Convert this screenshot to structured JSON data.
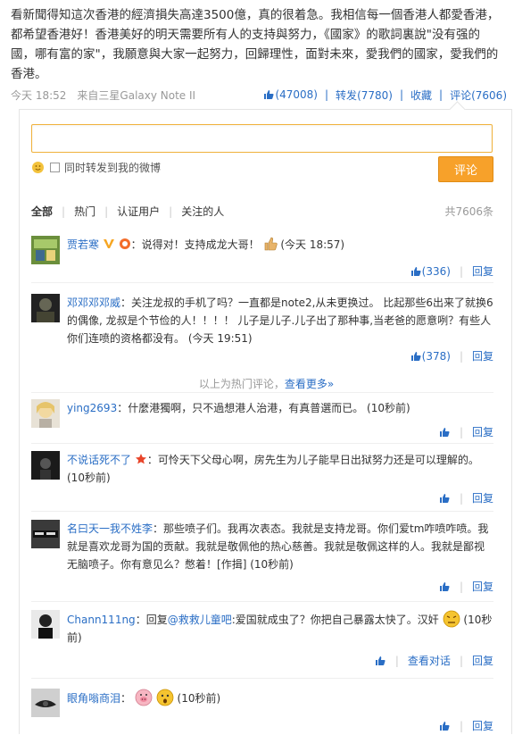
{
  "post": {
    "text": "看新聞得知這次香港的經濟損失高達3500億，真的很着急。我相信每一個香港人都愛香港，都希望香港好！香港美好的明天需要所有人的支持與努力，《國家》的歌詞裏說\"没有强的國，哪有富的家\"，我願意與大家一起努力，回歸理性，面對未來，愛我們的國家，愛我們的香港。"
  },
  "meta": {
    "time": "今天 18:52",
    "source_prefix": "来自",
    "source": "三星Galaxy Note II",
    "like_count": "(47008)",
    "repost_label": "转发",
    "repost_count": "(7780)",
    "favorite_label": "收藏",
    "comment_label": "评论",
    "comment_count": "(7606)"
  },
  "compose": {
    "placeholder": "",
    "also_repost_label": "同时转发到我的微博",
    "submit_label": "评论"
  },
  "tabs": {
    "items": [
      "全部",
      "热门",
      "认证用户",
      "关注的人"
    ],
    "total": "共7606条"
  },
  "hot_comments": [
    {
      "name": "贾若寒",
      "text": "：说得对！支持成龙大哥！",
      "time": "(今天 18:57)",
      "likes": "(336)",
      "reply": "回复"
    },
    {
      "name": "邓邓邓邓威",
      "text": "：关注龙叔的手机了吗？一直都是note2,从未更换过。 比起那些6出来了就换6的偶像, 龙叔是个节俭的人！！！！ 儿子是儿子.儿子出了那种事,当老爸的愿意咧？有些人你们连喷的资格都没有。",
      "time": "(今天 19:51)",
      "likes": "(378)",
      "reply": "回复"
    }
  ],
  "hot_footer": {
    "text": "以上为热门评论，",
    "link": "查看更多»"
  },
  "comments": [
    {
      "name": "ying2693",
      "text": "：什麼港獨啊，只不過想港人治港，有真普選而已。",
      "time": "(10秒前)",
      "reply": "回复"
    },
    {
      "name": "不说话死不了",
      "text": "：可怜天下父母心啊，房先生为儿子能早日出狱努力还是可以理解的。",
      "time": "(10秒前)",
      "reply": "回复"
    },
    {
      "name": "名曰天一我不姓李",
      "text": "：那些喷子们。我再次表态。我就是支持龙哥。你们爱tm咋喷咋喷。我就是喜欢龙哥为国的贡献。我就是敬佩他的热心慈善。我就是敬佩这样的人。我就是鄙视无脑喷子。你有意见么？憋着！",
      "tag": "[作揖]",
      "time": "(10秒前)",
      "reply": "回复"
    },
    {
      "name": "Chann111ng",
      "reply_prefix": "：回复",
      "mention": "@救救儿童吧",
      "text": ":爱国就成虫了？你把自己暴露太快了。汉奸",
      "time": "(10秒前)",
      "view_thread": "查看对话",
      "reply": "回复"
    },
    {
      "name": "眼角嗡商泪",
      "text": "：",
      "time": "(10秒前)",
      "reply": "回复"
    }
  ],
  "colors": {
    "accent": "#2a6ec5",
    "button": "#f7a12a",
    "input_border": "#f0b23c"
  },
  "icons": [
    "thumbs-up-icon",
    "smiley-icon",
    "checkbox-icon",
    "verified-v-icon",
    "pig-emoticon",
    "angry-emoticon"
  ]
}
